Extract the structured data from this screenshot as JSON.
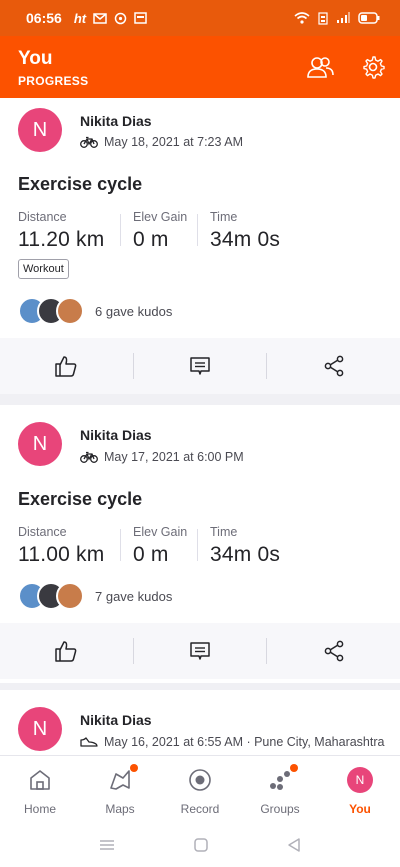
{
  "status_bar": {
    "time": "06:56",
    "ht": "ht"
  },
  "header": {
    "title": "You",
    "subtitle": "PROGRESS"
  },
  "feed": [
    {
      "avatar_initial": "N",
      "athlete": "Nikita Dias",
      "sport_icon": "bicycle-icon",
      "date": "May 18, 2021 at 7:23 AM",
      "title": "Exercise cycle",
      "stats": [
        {
          "label": "Distance",
          "value": "11.20 km"
        },
        {
          "label": "Elev Gain",
          "value": "0 m"
        },
        {
          "label": "Time",
          "value": "34m 0s"
        }
      ],
      "tag": "Workout",
      "kudos": "6 gave kudos"
    },
    {
      "avatar_initial": "N",
      "athlete": "Nikita Dias",
      "sport_icon": "bicycle-icon",
      "date": "May 17, 2021 at 6:00 PM",
      "title": "Exercise cycle",
      "stats": [
        {
          "label": "Distance",
          "value": "11.00 km"
        },
        {
          "label": "Elev Gain",
          "value": "0 m"
        },
        {
          "label": "Time",
          "value": "34m 0s"
        }
      ],
      "kudos": "7 gave kudos"
    },
    {
      "avatar_initial": "N",
      "athlete": "Nikita Dias",
      "sport_icon": "shoe-icon",
      "date": "May 16, 2021 at 6:55 AM · Pune City, Maharashtra"
    }
  ],
  "bottom_nav": [
    {
      "label": "Home",
      "icon": "home-icon"
    },
    {
      "label": "Maps",
      "icon": "map-icon",
      "badge": true
    },
    {
      "label": "Record",
      "icon": "record-icon"
    },
    {
      "label": "Groups",
      "icon": "groups-icon",
      "badge": true
    },
    {
      "label": "You",
      "icon": "avatar",
      "initial": "N",
      "active": true
    }
  ],
  "colors": {
    "brand": "#fc5200",
    "avatar": "#e8457a"
  }
}
